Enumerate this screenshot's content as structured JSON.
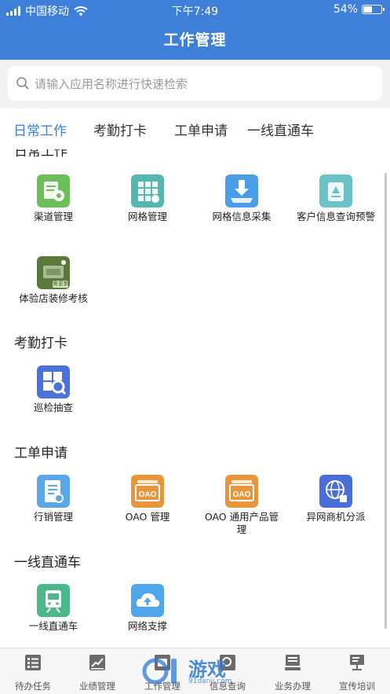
{
  "status": {
    "carrier": "中国移动",
    "time": "下午7:49",
    "battery": "54%",
    "battery_level": 0.54
  },
  "header": {
    "title": "工作管理"
  },
  "search": {
    "placeholder": "请输入应用名称进行快速检索"
  },
  "tabs": [
    {
      "label": "日常工作",
      "active": true
    },
    {
      "label": "考勤打卡",
      "active": false
    },
    {
      "label": "工单申请",
      "active": false
    },
    {
      "label": "一线直通车",
      "active": false
    }
  ],
  "sections": {
    "daily": {
      "title": "日常工作",
      "items": [
        {
          "label": "渠道管理",
          "icon": "channel-settings-icon",
          "color": "#6dbf5a"
        },
        {
          "label": "网格管理",
          "icon": "grid-icon",
          "color": "#54b8b0"
        },
        {
          "label": "网格信息采集",
          "icon": "download-tray-icon",
          "color": "#4b9de8"
        },
        {
          "label": "客户信息查询预警",
          "icon": "phone-alert-icon",
          "color": "#6ac3c7"
        },
        {
          "label": "体验店装修考核",
          "icon": "store-icon",
          "color": "#5a7a3c",
          "badge": "需更新"
        }
      ]
    },
    "attendance": {
      "title": "考勤打卡",
      "items": [
        {
          "label": "巡检抽查",
          "icon": "inspection-icon",
          "color": "#4a72d8"
        }
      ]
    },
    "orders": {
      "title": "工单申请",
      "items": [
        {
          "label": "行销管理",
          "icon": "document-icon",
          "color": "#5aa8e8"
        },
        {
          "label": "OAO 管理",
          "icon": "oao-icon",
          "color": "#e8963a",
          "text": "OAO"
        },
        {
          "label": "OAO 通用产品管理",
          "icon": "oao-product-icon",
          "color": "#e8963a",
          "text": "OAO"
        },
        {
          "label": "异网商机分派",
          "icon": "globe-icon",
          "color": "#4a6fd8"
        }
      ]
    },
    "express": {
      "title": "一线直通车",
      "items": [
        {
          "label": "一线直通车",
          "icon": "train-icon",
          "color": "#4cb88a"
        },
        {
          "label": "网络支撑",
          "icon": "cloud-upload-icon",
          "color": "#4fa6ea"
        }
      ]
    }
  },
  "tabbar": [
    {
      "label": "待办任务",
      "icon": "todo-icon"
    },
    {
      "label": "业绩管理",
      "icon": "performance-icon"
    },
    {
      "label": "工作管理",
      "icon": "work-icon"
    },
    {
      "label": "信息查询",
      "icon": "info-query-icon"
    },
    {
      "label": "业务办理",
      "icon": "business-icon"
    },
    {
      "label": "宣传培训",
      "icon": "training-icon"
    }
  ],
  "watermark": {
    "text": "游戏",
    "sub": "91danji.com"
  }
}
